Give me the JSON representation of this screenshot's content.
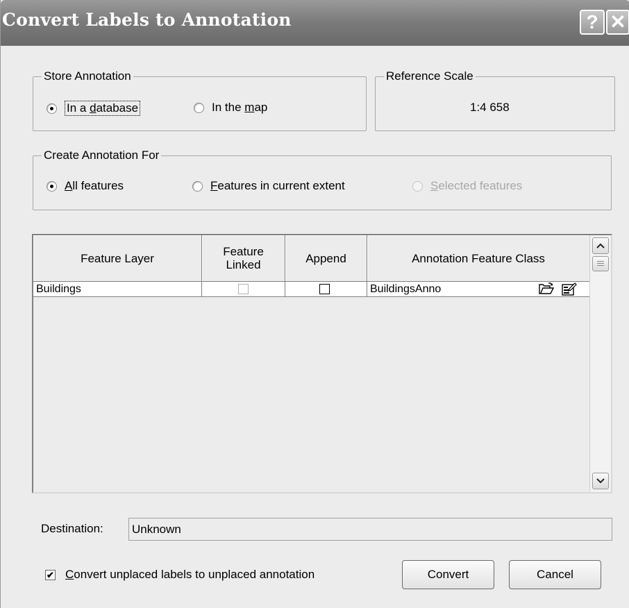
{
  "window": {
    "title": "Convert Labels to Annotation",
    "help_glyph": "?",
    "close_glyph": "✕"
  },
  "store_annotation": {
    "legend": "Store Annotation",
    "options": [
      {
        "pre": "In a ",
        "accel": "d",
        "post": "atabase",
        "checked": true
      },
      {
        "pre": "In the ",
        "accel": "m",
        "post": "ap",
        "checked": false
      }
    ]
  },
  "reference_scale": {
    "legend": "Reference Scale",
    "value": "1:4 658"
  },
  "create_annotation_for": {
    "legend": "Create Annotation For",
    "options": [
      {
        "pre": "",
        "accel": "A",
        "post": "ll features",
        "checked": true,
        "enabled": true
      },
      {
        "pre": "",
        "accel": "F",
        "post": "eatures in current extent",
        "checked": false,
        "enabled": true
      },
      {
        "pre": "",
        "accel": "S",
        "post": "elected features",
        "checked": false,
        "enabled": false
      }
    ]
  },
  "table": {
    "headers": [
      "Feature Layer",
      "Feature Linked",
      "Append",
      "Annotation Feature Class"
    ],
    "rows": [
      {
        "feature_layer": "Buildings",
        "feature_linked": false,
        "append": false,
        "annotation_class": "BuildingsAnno"
      }
    ]
  },
  "destination": {
    "label": "Destination:",
    "value": "Unknown"
  },
  "convert_unplaced": {
    "pre": "",
    "accel": "C",
    "post": "onvert unplaced labels to unplaced annotation",
    "checked": true
  },
  "buttons": {
    "convert": "Convert",
    "cancel": "Cancel"
  },
  "icons": {
    "browse": "open-folder-icon",
    "properties": "properties-icon",
    "scroll_up": "scroll-up-icon",
    "scroll_down": "scroll-down-icon"
  }
}
